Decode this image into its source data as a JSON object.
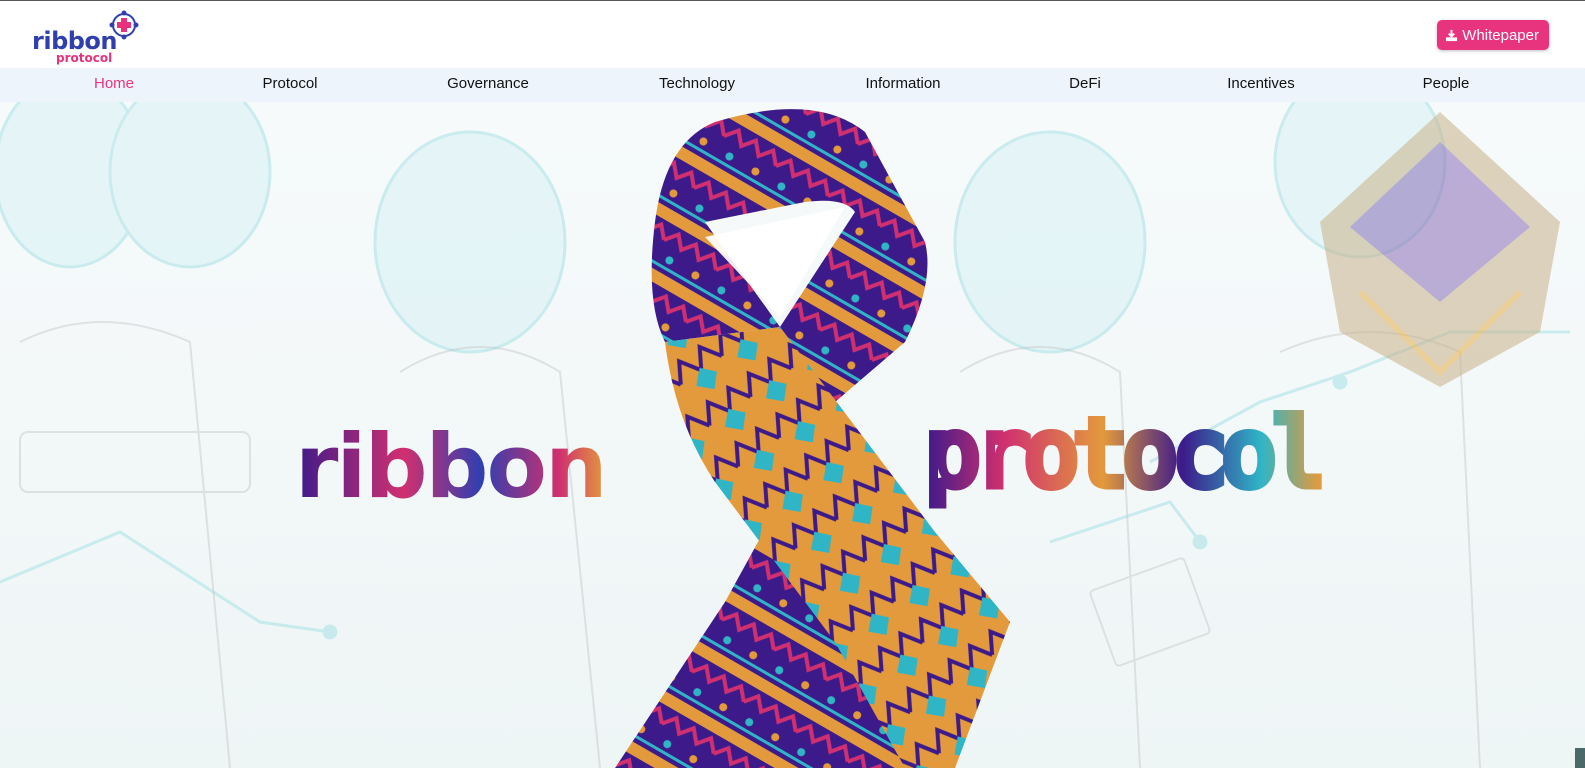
{
  "header": {
    "logo": {
      "name": "ribbon",
      "sub": "protocol"
    },
    "whitepaper_button": {
      "label": "Whitepaper",
      "icon": "download-icon"
    }
  },
  "nav": {
    "items": [
      {
        "label": "Home",
        "active": true
      },
      {
        "label": "Protocol",
        "active": false
      },
      {
        "label": "Governance",
        "active": false
      },
      {
        "label": "Technology",
        "active": false
      },
      {
        "label": "Information",
        "active": false
      },
      {
        "label": "DeFi",
        "active": false
      },
      {
        "label": "Incentives",
        "active": false
      },
      {
        "label": "People",
        "active": false
      }
    ]
  },
  "hero": {
    "word_left": "ribbon",
    "word_right": "protocol"
  },
  "colors": {
    "accent_pink": "#e8347f",
    "brand_blue": "#2f3fb0",
    "ribbon_purple": "#3d1a8a",
    "ribbon_orange": "#e39a3c",
    "ribbon_teal": "#2fb5c6",
    "ribbon_magenta": "#d0306f"
  }
}
